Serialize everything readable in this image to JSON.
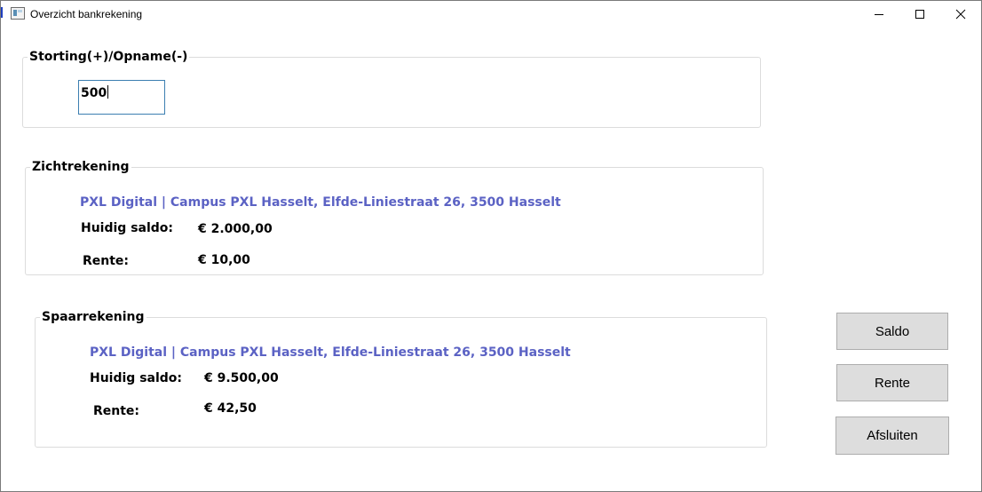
{
  "window": {
    "title": "Overzicht bankrekening",
    "app_icon": "window-app-icon",
    "controls": [
      "minimize-icon",
      "maximize-icon",
      "close-icon"
    ]
  },
  "deposit": {
    "group_title": "Storting(+)/Opname(-)",
    "amount_value": "500"
  },
  "checking": {
    "group_title": "Zichtrekening",
    "address": "PXL Digital | Campus PXL Hasselt, Elfde-Liniestraat 26, 3500 Hasselt",
    "balance_label": "Huidig saldo:",
    "balance_value": "€ 2.000,00",
    "interest_label": "Rente:",
    "interest_value": "€ 10,00"
  },
  "savings": {
    "group_title": "Spaarrekening",
    "address": "PXL Digital | Campus PXL Hasselt, Elfde-Liniestraat 26, 3500 Hasselt",
    "balance_label": "Huidig saldo:",
    "balance_value": "€ 9.500,00",
    "interest_label": "Rente:",
    "interest_value": "€ 42,50"
  },
  "buttons": {
    "balance": "Saldo",
    "interest": "Rente",
    "close": "Afsluiten"
  },
  "colors": {
    "address_text": "#5b62c4",
    "input_border": "#3c7fb1",
    "button_bg": "#dddddd"
  }
}
